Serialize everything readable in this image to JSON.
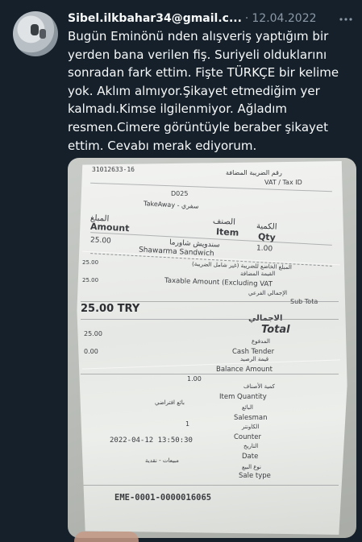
{
  "tweet": {
    "author_email": "Sibel.ilkbahar34@gmail.c...",
    "separator": "·",
    "date": "12.04.2022",
    "text": "Bugün Eminönü nden alışveriş yaptığım bir yerden bana verilen fiş. Suriyeli olduklarını sonradan fark ettim. Fişte TÜRKÇE bir kelime yok. Aklım almıyor.Şikayet etmediğim yer kalmadı.Kimse ilgilenmiyor. Ağladım resmen.Cimere görüntüyle beraber şikayet ettim. Cevabı merak ediyorum."
  },
  "icons": {
    "more": "more-horizontal-icon"
  },
  "receipt": {
    "tax_number": "31012633-16",
    "vat_ar": "رقم الضريبة المضافة",
    "vat_label": "VAT / Tax ID",
    "code": "D025",
    "takeaway": "TakeAway - سفري",
    "amount_ar": "المبلغ",
    "amount_label": "Amount",
    "item_ar": "الصنف",
    "item_label": "Item",
    "qty_ar": "الكمية",
    "qty_label": "Qty",
    "row_amount": "25.00",
    "row_item_ar": "سندويش شاورما",
    "row_item": "Shawarma Sandwich",
    "row_qty": "1.00",
    "taxable_amount_value": "25.00",
    "taxable_ar": "المبلغ الخاضع للضريبة (غير شامل الضريبة)",
    "tax_ar": "القيمة المضافة",
    "taxable_value": "25.00",
    "taxable_label": "Taxable Amount (Excluding VAT",
    "subtotal_ar": "الإجمالي الفرعي",
    "subtotal_label": "Sub Tota",
    "total_value": "25.00 TRY",
    "total_ar": "الاجمالي",
    "total_label": "Total",
    "cash_value": "25.00",
    "cash_ar": "المدفوع",
    "cash_label": "Cash Tender",
    "balance_value": "0.00",
    "balance_ar": "قيمة الرصيد",
    "balance_label": "Balance Amount",
    "iq_value": "1.00",
    "iq_ar": "كمية الأصناف",
    "iq_label": "Item Quantity",
    "salesman_value_ar": "بائع افتراضي",
    "salesman_ar": "البائع",
    "salesman_label": "Salesman",
    "counter_value": "1",
    "counter_ar": "الكاونتر",
    "counter_label": "Counter",
    "date_value": "2022-04-12 13:50:30",
    "date_ar": "التاريخ",
    "date_label": "Date",
    "saletype_value_ar": "مبيعات - نقدية",
    "saletype_ar": "نوع البيع",
    "saletype_label": "Sale type",
    "receipt_no": "EME-0001-0000016065"
  }
}
